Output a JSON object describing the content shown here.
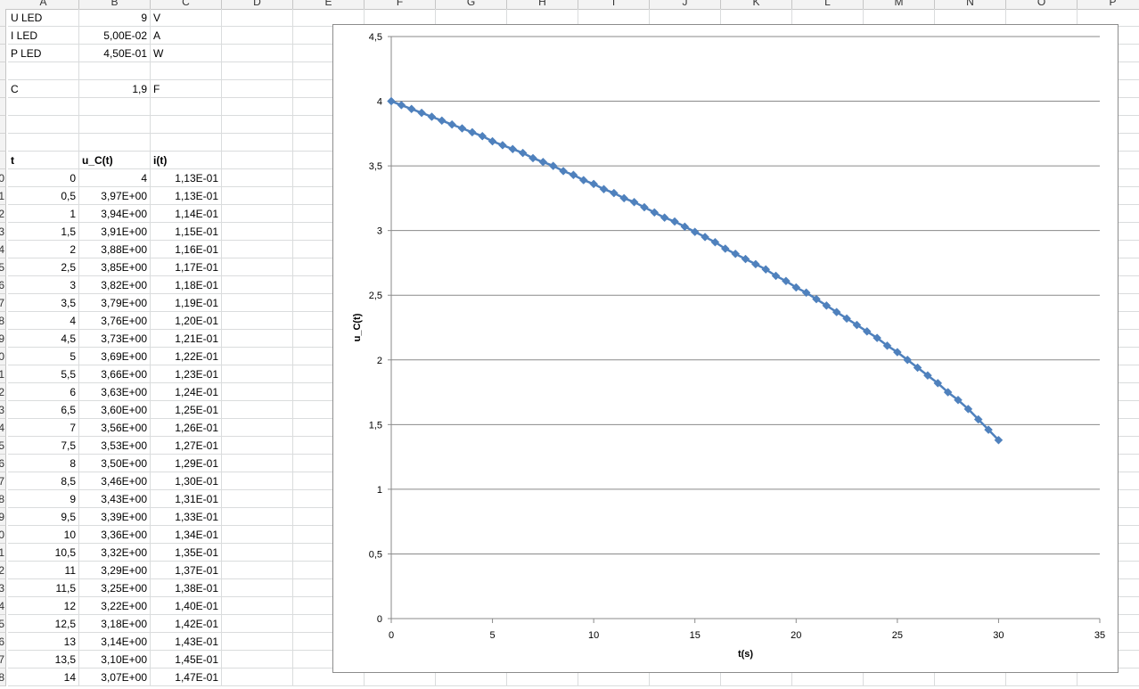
{
  "columns": [
    "A",
    "B",
    "C",
    "D",
    "E",
    "F",
    "G",
    "H",
    "I",
    "J",
    "K",
    "L",
    "M",
    "N",
    "O",
    "P"
  ],
  "params": [
    {
      "label": "U LED",
      "value": "9",
      "unit": "V"
    },
    {
      "label": "I LED",
      "value": "5,00E-02",
      "unit": "A"
    },
    {
      "label": "P LED",
      "value": "4,50E-01",
      "unit": "W"
    },
    {
      "label": "",
      "value": "",
      "unit": ""
    },
    {
      "label": "C",
      "value": "1,9",
      "unit": "F"
    }
  ],
  "table": {
    "headers": [
      "t",
      "u_C(t)",
      "i(t)"
    ],
    "rows": [
      [
        "0",
        "4",
        "1,13E-01"
      ],
      [
        "0,5",
        "3,97E+00",
        "1,13E-01"
      ],
      [
        "1",
        "3,94E+00",
        "1,14E-01"
      ],
      [
        "1,5",
        "3,91E+00",
        "1,15E-01"
      ],
      [
        "2",
        "3,88E+00",
        "1,16E-01"
      ],
      [
        "2,5",
        "3,85E+00",
        "1,17E-01"
      ],
      [
        "3",
        "3,82E+00",
        "1,18E-01"
      ],
      [
        "3,5",
        "3,79E+00",
        "1,19E-01"
      ],
      [
        "4",
        "3,76E+00",
        "1,20E-01"
      ],
      [
        "4,5",
        "3,73E+00",
        "1,21E-01"
      ],
      [
        "5",
        "3,69E+00",
        "1,22E-01"
      ],
      [
        "5,5",
        "3,66E+00",
        "1,23E-01"
      ],
      [
        "6",
        "3,63E+00",
        "1,24E-01"
      ],
      [
        "6,5",
        "3,60E+00",
        "1,25E-01"
      ],
      [
        "7",
        "3,56E+00",
        "1,26E-01"
      ],
      [
        "7,5",
        "3,53E+00",
        "1,27E-01"
      ],
      [
        "8",
        "3,50E+00",
        "1,29E-01"
      ],
      [
        "8,5",
        "3,46E+00",
        "1,30E-01"
      ],
      [
        "9",
        "3,43E+00",
        "1,31E-01"
      ],
      [
        "9,5",
        "3,39E+00",
        "1,33E-01"
      ],
      [
        "10",
        "3,36E+00",
        "1,34E-01"
      ],
      [
        "10,5",
        "3,32E+00",
        "1,35E-01"
      ],
      [
        "11",
        "3,29E+00",
        "1,37E-01"
      ],
      [
        "11,5",
        "3,25E+00",
        "1,38E-01"
      ],
      [
        "12",
        "3,22E+00",
        "1,40E-01"
      ],
      [
        "12,5",
        "3,18E+00",
        "1,42E-01"
      ],
      [
        "13",
        "3,14E+00",
        "1,43E-01"
      ],
      [
        "13,5",
        "3,10E+00",
        "1,45E-01"
      ],
      [
        "14",
        "3,07E+00",
        "1,47E-01"
      ]
    ]
  },
  "row_numbers": [
    "",
    "",
    "",
    "",
    "",
    "",
    "",
    "",
    "",
    "0",
    "1",
    "2",
    "3",
    "4",
    "5",
    "6",
    "7",
    "8",
    "9",
    "0",
    "1",
    "2",
    "3",
    "4",
    "5",
    "6",
    "7",
    "8",
    "9",
    "0",
    "1",
    "2",
    "3",
    "4",
    "5",
    "6",
    "7",
    "8"
  ],
  "chart_data": {
    "type": "scatter",
    "title": "",
    "xlabel": "t(s)",
    "ylabel": "u_C(t)",
    "xlim": [
      0,
      35
    ],
    "ylim": [
      0,
      4.5
    ],
    "xticks": [
      "0",
      "5",
      "10",
      "15",
      "20",
      "25",
      "30",
      "35"
    ],
    "yticks": [
      "0",
      "0,5",
      "1",
      "1,5",
      "2",
      "2,5",
      "3",
      "3,5",
      "4",
      "4,5"
    ],
    "grid": "horizontal major gridlines",
    "marker": "diamond",
    "line": "smooth",
    "color": "#4f81bd",
    "x": [
      0,
      0.5,
      1,
      1.5,
      2,
      2.5,
      3,
      3.5,
      4,
      4.5,
      5,
      5.5,
      6,
      6.5,
      7,
      7.5,
      8,
      8.5,
      9,
      9.5,
      10,
      10.5,
      11,
      11.5,
      12,
      12.5,
      13,
      13.5,
      14,
      14.5,
      15,
      15.5,
      16,
      16.5,
      17,
      17.5,
      18,
      18.5,
      19,
      19.5,
      20,
      20.5,
      21,
      21.5,
      22,
      22.5,
      23,
      23.5,
      24,
      24.5,
      25,
      25.5,
      26,
      26.5,
      27,
      27.5,
      28,
      28.5,
      29,
      29.5,
      30
    ],
    "y": [
      4,
      3.97,
      3.94,
      3.91,
      3.88,
      3.85,
      3.82,
      3.79,
      3.76,
      3.73,
      3.69,
      3.66,
      3.63,
      3.6,
      3.56,
      3.53,
      3.5,
      3.46,
      3.43,
      3.39,
      3.36,
      3.32,
      3.29,
      3.25,
      3.22,
      3.18,
      3.14,
      3.1,
      3.07,
      3.03,
      2.99,
      2.95,
      2.91,
      2.86,
      2.82,
      2.78,
      2.74,
      2.7,
      2.65,
      2.61,
      2.56,
      2.52,
      2.47,
      2.42,
      2.37,
      2.32,
      2.27,
      2.22,
      2.17,
      2.11,
      2.06,
      2.0,
      1.94,
      1.88,
      1.82,
      1.75,
      1.69,
      1.62,
      1.54,
      1.46,
      1.38
    ]
  }
}
